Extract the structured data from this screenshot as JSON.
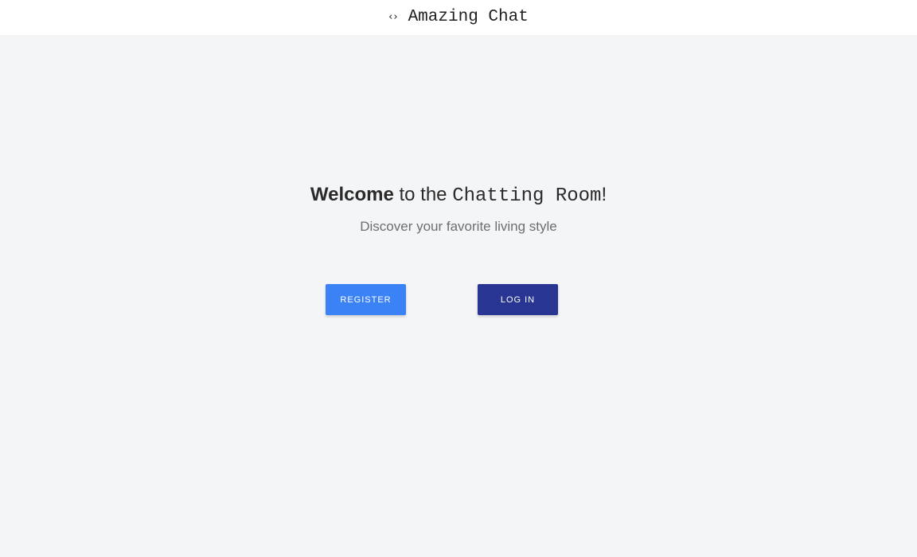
{
  "header": {
    "icon": "code-brackets-icon",
    "icon_glyph": "‹›",
    "title": "Amazing Chat"
  },
  "hero": {
    "welcome": "Welcome",
    "to_the": " to the ",
    "room": "Chatting Room",
    "exclaim": "!",
    "tagline": "Discover your favorite living style"
  },
  "buttons": {
    "register_label": "REGISTER",
    "login_label": "LOG IN"
  },
  "colors": {
    "background": "#f4f5f7",
    "header_background": "#ffffff",
    "register": "#3b82f6",
    "login": "#283593"
  }
}
